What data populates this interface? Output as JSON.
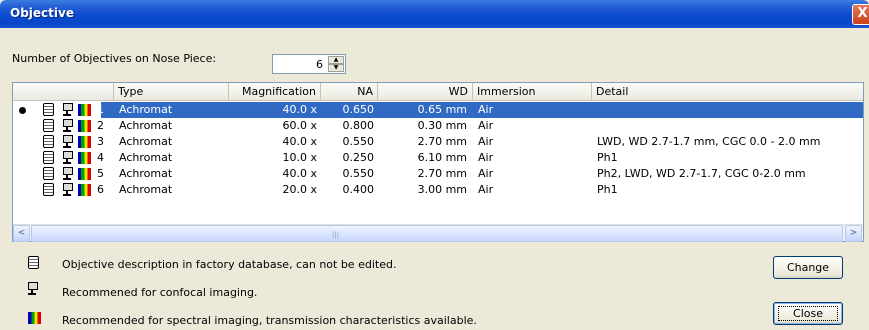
{
  "window": {
    "title": "Objective",
    "close_glyph": "X"
  },
  "nose_piece": {
    "label": "Number of Objectives on Nose Piece:",
    "value": "6",
    "up_glyph": "▲",
    "down_glyph": "▼"
  },
  "table": {
    "columns": [
      "Type",
      "Magnification",
      "NA",
      "WD",
      "Immersion",
      "Detail"
    ],
    "rows": [
      {
        "num": "1",
        "type": "Achromat",
        "mag": "40.0 x",
        "na": "0.650",
        "wd": "0.65 mm",
        "imm": "Air",
        "detail": "",
        "selected": true,
        "current": true
      },
      {
        "num": "2",
        "type": "Achromat",
        "mag": "60.0 x",
        "na": "0.800",
        "wd": "0.30 mm",
        "imm": "Air",
        "detail": ""
      },
      {
        "num": "3",
        "type": "Achromat",
        "mag": "40.0 x",
        "na": "0.550",
        "wd": "2.70 mm",
        "imm": "Air",
        "detail": "LWD, WD 2.7-1.7 mm, CGC 0.0 - 2.0 mm"
      },
      {
        "num": "4",
        "type": "Achromat",
        "mag": "10.0 x",
        "na": "0.250",
        "wd": "6.10 mm",
        "imm": "Air",
        "detail": "Ph1"
      },
      {
        "num": "5",
        "type": "Achromat",
        "mag": "40.0 x",
        "na": "0.550",
        "wd": "2.70 mm",
        "imm": "Air",
        "detail": "Ph2, LWD, WD 2.7-1.7, CGC 0-2.0 mm"
      },
      {
        "num": "6",
        "type": "Achromat",
        "mag": "20.0 x",
        "na": "0.400",
        "wd": "3.00 mm",
        "imm": "Air",
        "detail": "Ph1"
      }
    ],
    "scroll_left_glyph": "<",
    "scroll_right_glyph": ">",
    "scroll_grip": "|||"
  },
  "legend": {
    "factory_db": "Objective description in factory database, can not be edited.",
    "confocal": "Recommened for confocal imaging.",
    "spectral": "Recommended for spectral imaging, transmission characteristics available."
  },
  "buttons": {
    "change": "Change",
    "close": "Close"
  },
  "icons": {
    "factory": "database-icon",
    "confocal": "monitor-icon",
    "spectral": "spectrum-icon",
    "current": "bullet-icon"
  }
}
